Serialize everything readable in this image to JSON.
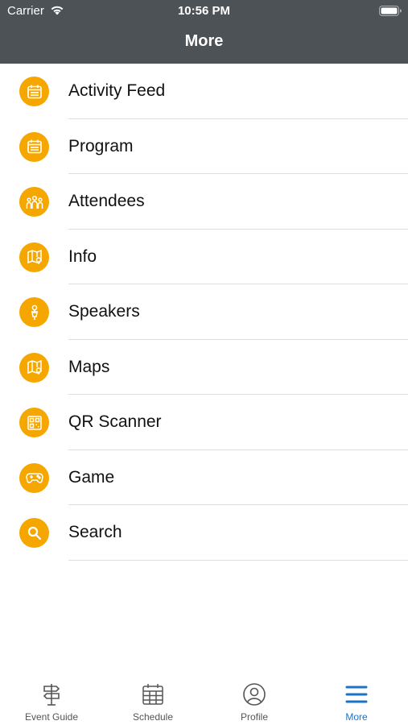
{
  "status_bar": {
    "carrier": "Carrier",
    "time": "10:56 PM"
  },
  "header": {
    "title": "More"
  },
  "menu": {
    "items": [
      {
        "label": "Activity Feed",
        "icon": "calendar-icon"
      },
      {
        "label": "Program",
        "icon": "calendar-icon"
      },
      {
        "label": "Attendees",
        "icon": "people-icon"
      },
      {
        "label": "Info",
        "icon": "map-pin-icon"
      },
      {
        "label": "Speakers",
        "icon": "speaker-icon"
      },
      {
        "label": "Maps",
        "icon": "map-pin-icon"
      },
      {
        "label": "QR Scanner",
        "icon": "qr-code-icon"
      },
      {
        "label": "Game",
        "icon": "gamepad-icon"
      },
      {
        "label": "Search",
        "icon": "search-icon"
      }
    ]
  },
  "tab_bar": {
    "tabs": [
      {
        "label": "Event Guide",
        "icon": "signpost-icon"
      },
      {
        "label": "Schedule",
        "icon": "calendar-icon"
      },
      {
        "label": "Profile",
        "icon": "profile-icon"
      },
      {
        "label": "More",
        "icon": "menu-icon",
        "active": true
      }
    ]
  },
  "colors": {
    "header_bg": "#4d5256",
    "accent": "#f5a700",
    "active_tab": "#1c73c6"
  }
}
